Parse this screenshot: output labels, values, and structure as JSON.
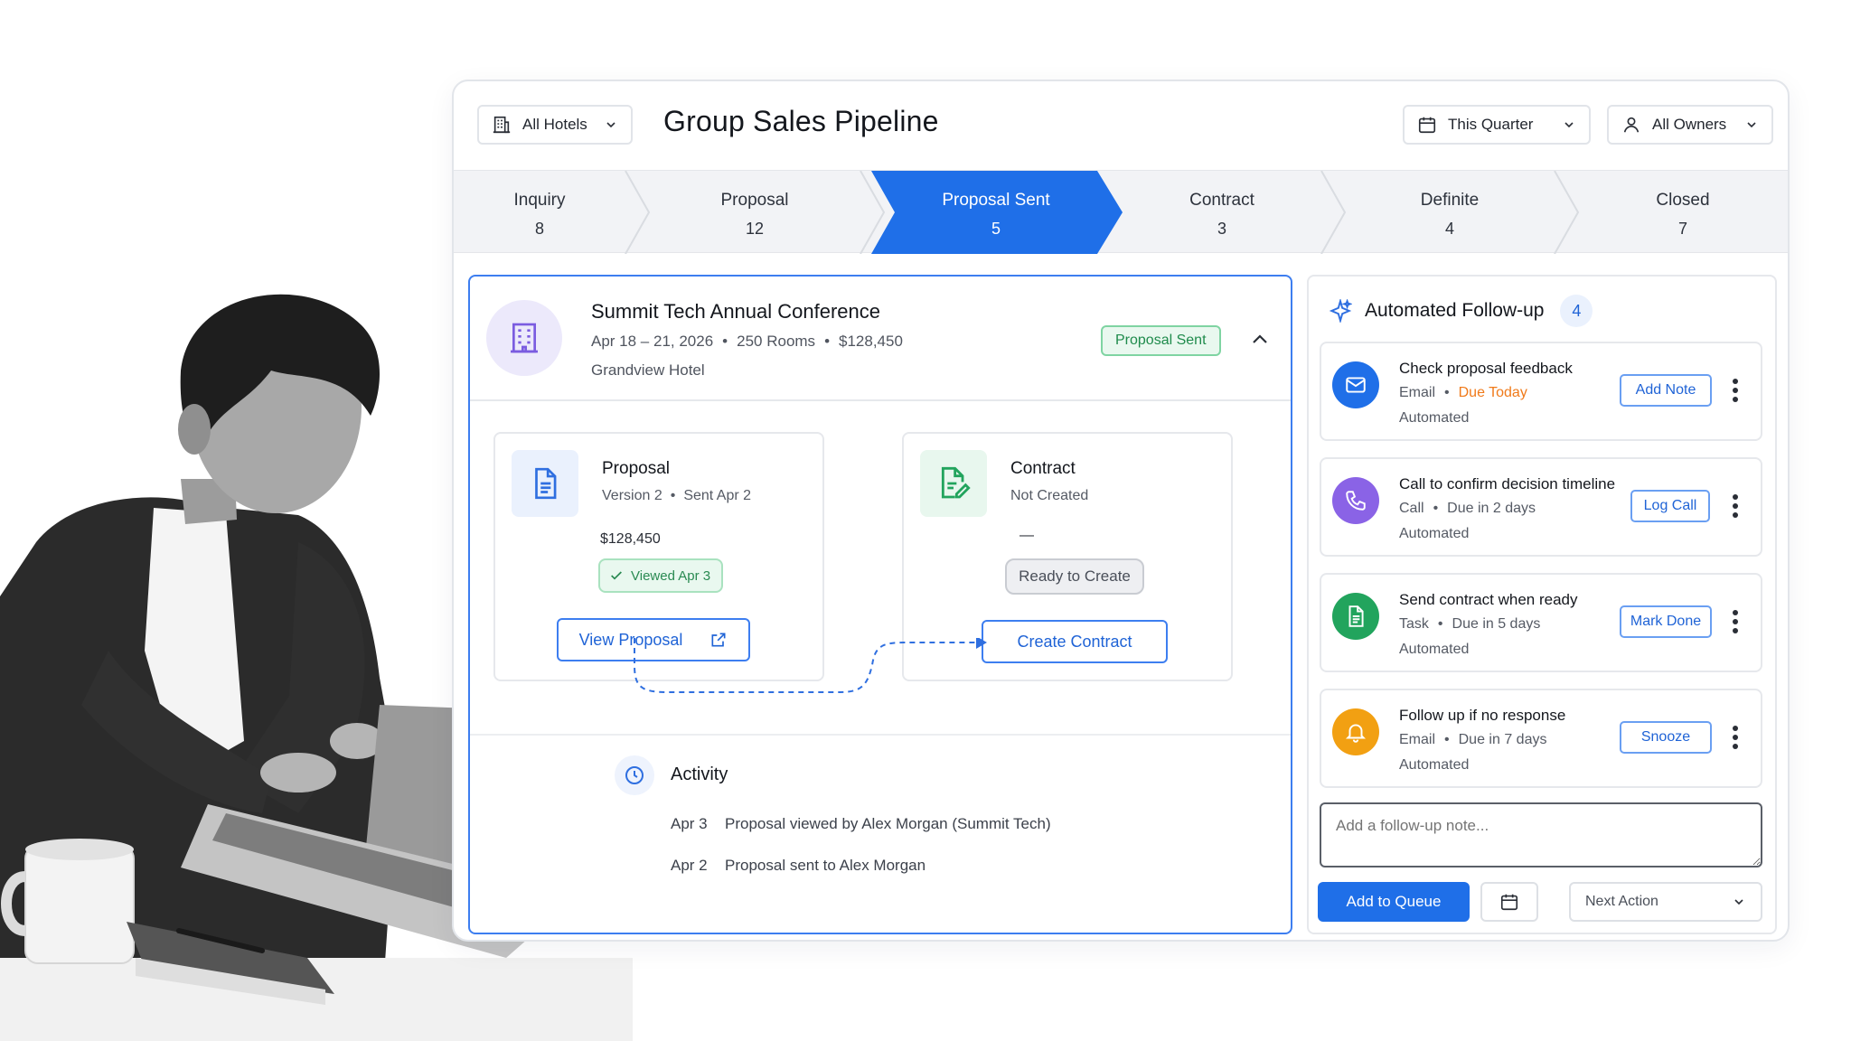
{
  "header": {
    "hotel_filter": "All Hotels",
    "title": "Group Sales Pipeline",
    "period_filter": "This Quarter",
    "owner_filter": "All Owners"
  },
  "stages": [
    {
      "name": "Inquiry",
      "count": "8"
    },
    {
      "name": "Proposal",
      "count": "12"
    },
    {
      "name": "Proposal Sent",
      "count": "5",
      "active": true
    },
    {
      "name": "Contract",
      "count": "3"
    },
    {
      "name": "Definite",
      "count": "4"
    },
    {
      "name": "Closed",
      "count": "7"
    }
  ],
  "event": {
    "title": "Summit Tech Annual Conference",
    "dates": "Apr 18 – 21, 2026",
    "rooms": "250 Rooms",
    "value": "$128,450",
    "hotel": "Grandview Hotel",
    "status": "Proposal Sent",
    "proposal": {
      "name": "Proposal",
      "version": "Version 2",
      "sent": "Sent Apr 2",
      "amount": "$128,450",
      "viewed": "Viewed Apr 3",
      "button": "View Proposal"
    },
    "contract": {
      "name": "Contract",
      "status": "Not Created",
      "amount": "—",
      "ready": "Ready to Create",
      "button": "Create Contract"
    },
    "activity": {
      "title": "Activity",
      "items": [
        {
          "date": "Apr 3",
          "text": "Proposal viewed by Alex Morgan (Summit Tech)"
        },
        {
          "date": "Apr 2",
          "text": "Proposal sent to Alex Morgan"
        }
      ]
    }
  },
  "followup": {
    "title": "Automated Follow-up",
    "count": "4",
    "tasks": [
      {
        "title": "Check proposal feedback",
        "type": "Email",
        "due": "Due Today",
        "auto": "Automated",
        "button": "Add Note",
        "color": "#1f6fe8",
        "icon": "mail-icon"
      },
      {
        "title": "Call to confirm decision timeline",
        "type": "Call",
        "due": "Due in 2 days",
        "auto": "Automated",
        "button": "Log Call",
        "color": "#8a63e6",
        "icon": "phone-icon"
      },
      {
        "title": "Send contract when ready",
        "type": "Task",
        "due": "Due in 5 days",
        "auto": "Automated",
        "button": "Mark Done",
        "color": "#22a45d",
        "icon": "document-icon"
      },
      {
        "title": "Follow up if no response",
        "type": "Email",
        "due": "Due in 7 days",
        "auto": "Automated",
        "button": "Snooze",
        "color": "#f2a012",
        "icon": "bell-icon"
      }
    ],
    "note_placeholder": "Add a follow-up note...",
    "queue_button": "Add to Queue",
    "next_action": "Next Action"
  },
  "colors": {
    "accent": "#1f6fe8",
    "active_stage": "#1f6fe8",
    "success": "#22a45d",
    "warning": "#f07a1a"
  }
}
